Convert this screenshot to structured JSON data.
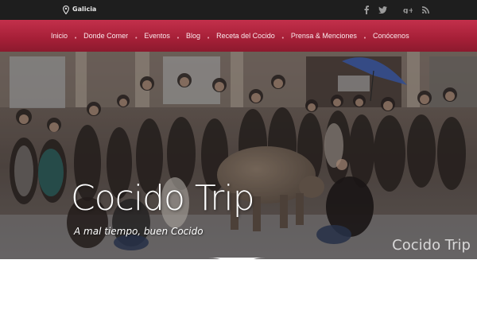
{
  "topbar": {
    "location": "Galicia",
    "icons": [
      "map-pin-icon",
      "facebook-icon",
      "twitter-icon",
      "google-plus-icon",
      "rss-icon"
    ]
  },
  "nav": {
    "items": [
      "Inicio",
      "Donde Comer",
      "Eventos",
      "Blog",
      "Receta del Cocido",
      "Prensa & Menciones",
      "Conócenos"
    ]
  },
  "hero": {
    "title": "Cocido Trip",
    "tagline": "A mal tiempo, buen Cocido",
    "watermark": "Cocido Trip"
  },
  "colors": {
    "topbar": "#1e1e1e",
    "nav_accent": "#b2253f"
  }
}
